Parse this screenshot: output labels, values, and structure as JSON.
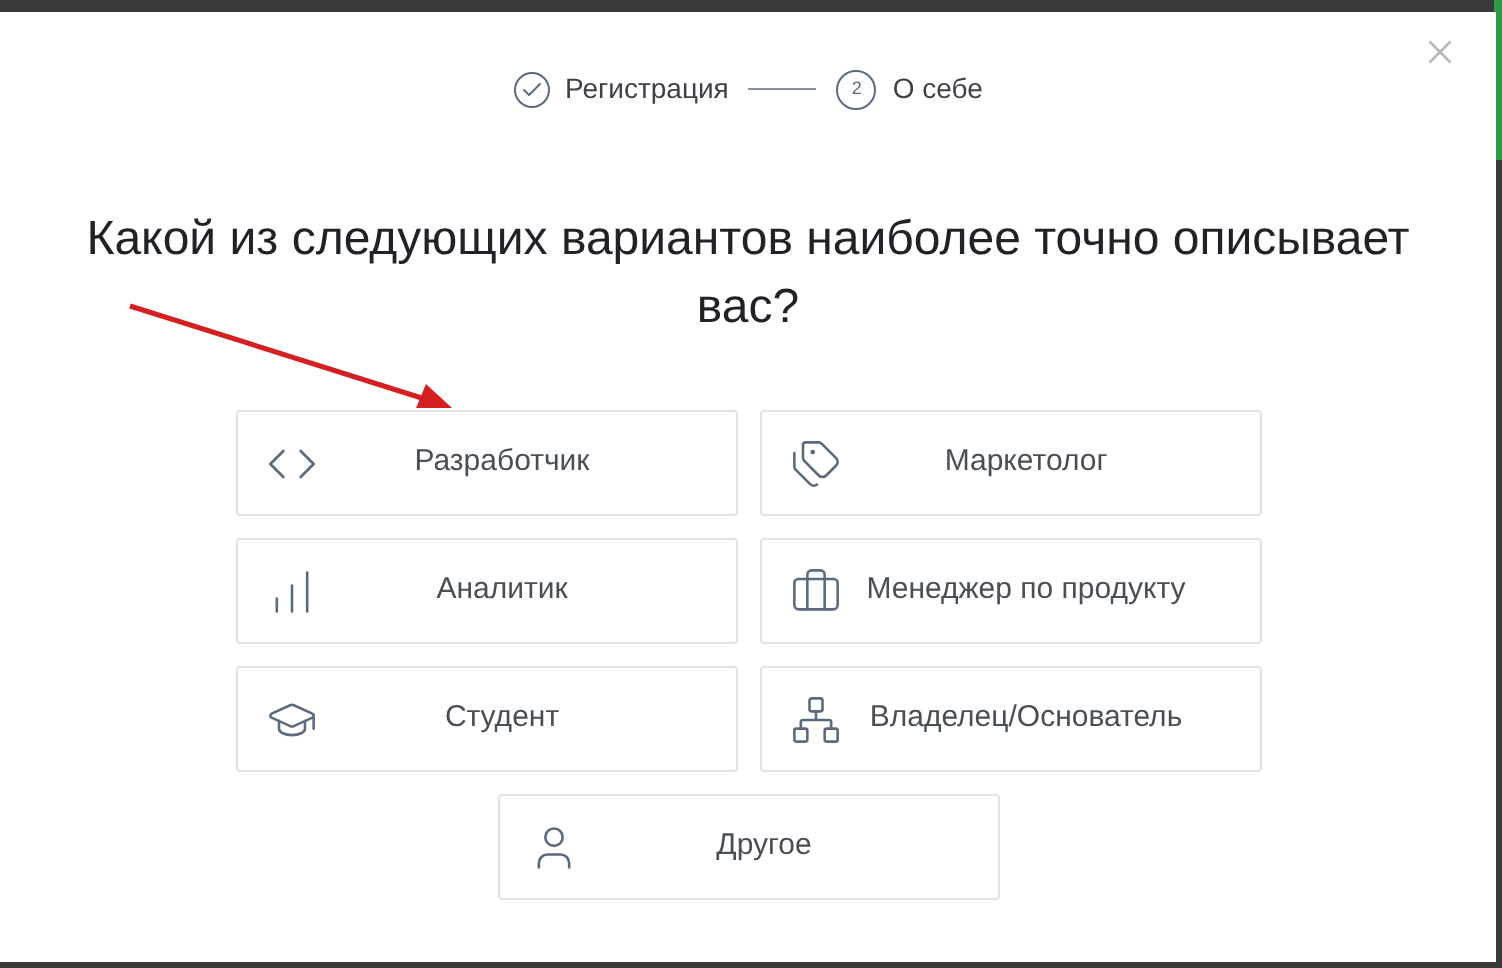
{
  "steps": [
    {
      "label": "Регистрация",
      "done": true
    },
    {
      "label": "О себе",
      "done": false,
      "number": "2"
    }
  ],
  "question": "Какой из следующих вариантов наиболее точно описывает вас?",
  "options": [
    {
      "label": "Разработчик",
      "kind": "code"
    },
    {
      "label": "Маркетолог",
      "kind": "tag"
    },
    {
      "label": "Аналитик",
      "kind": "bars"
    },
    {
      "label": "Менеджер по продукту",
      "kind": "briefcase"
    },
    {
      "label": "Студент",
      "kind": "cap"
    },
    {
      "label": "Владелец/Основатель",
      "kind": "hierarchy"
    },
    {
      "label": "Другое",
      "kind": "user"
    }
  ]
}
